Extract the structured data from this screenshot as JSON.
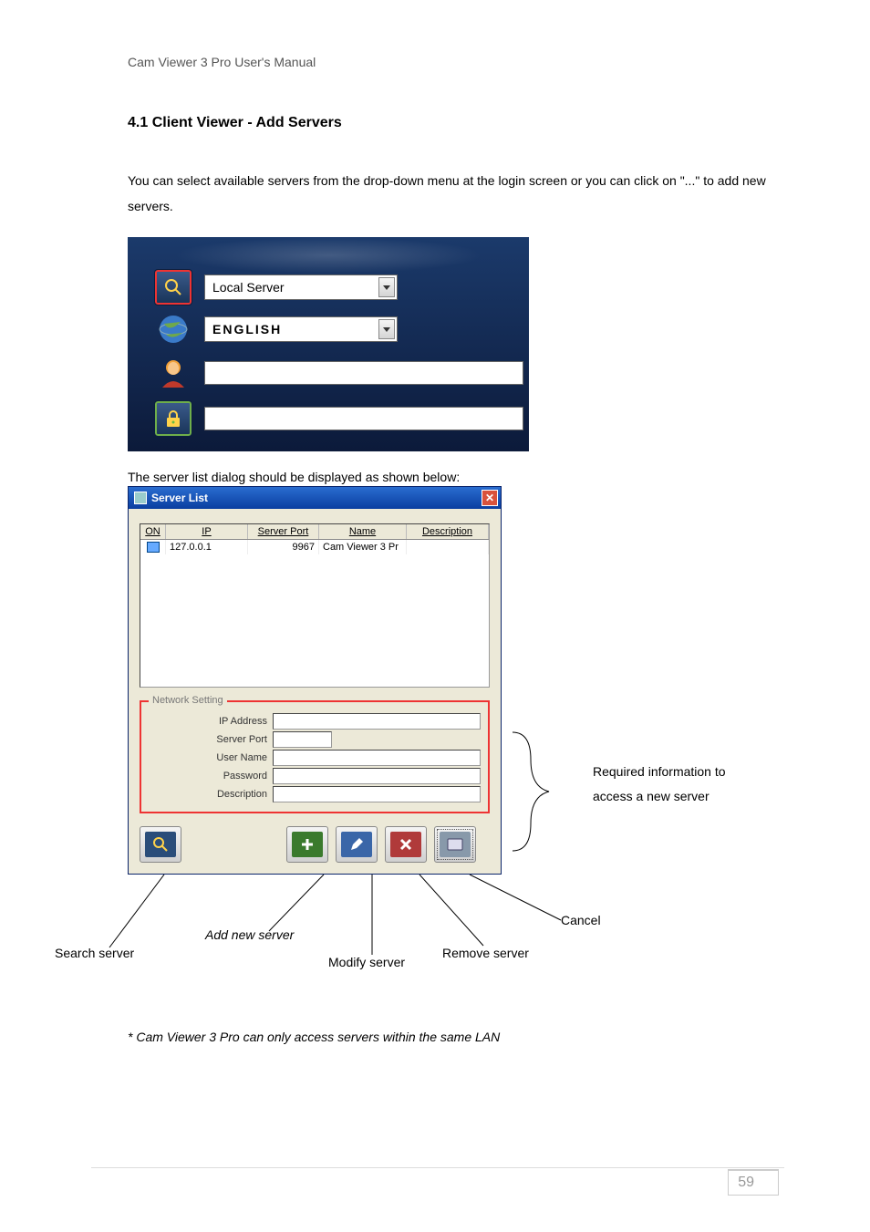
{
  "doc": {
    "header": "Cam  Viewer  3  Pro  User's  Manual",
    "section_title": "4.1 Client Viewer - Add Servers",
    "intro": "You can select available servers from the drop-down menu at the login screen or you can click on \"...\" to add new servers.",
    "caption2": "The server list dialog should be displayed as shown below:",
    "footnote": "* Cam Viewer 3 Pro can only access servers within the same LAN",
    "page_number": "59"
  },
  "login": {
    "server_dropdown": "Local Server",
    "language_dropdown": "ENGLISH",
    "username_value": "",
    "password_value": ""
  },
  "dialog": {
    "title": "Server List",
    "columns": {
      "c1": "ON",
      "c2": "IP",
      "c3": "Server Port",
      "c4": "Name",
      "c5": "Description"
    },
    "row": {
      "ip": "127.0.0.1",
      "port": "9967",
      "name": "Cam Viewer 3 Pr",
      "desc": ""
    },
    "group_title": "Network Setting",
    "labels": {
      "ip": "IP Address",
      "port": "Server Port",
      "user": "User Name",
      "pass": "Password",
      "desc": "Description"
    },
    "values": {
      "ip": "",
      "port": "",
      "user": "",
      "pass": "",
      "desc": ""
    }
  },
  "annotations": {
    "side": "Required information to access a new server",
    "search": "Search server",
    "add": "Add new server",
    "modify": "Modify server",
    "remove": "Remove server",
    "cancel": "Cancel"
  }
}
